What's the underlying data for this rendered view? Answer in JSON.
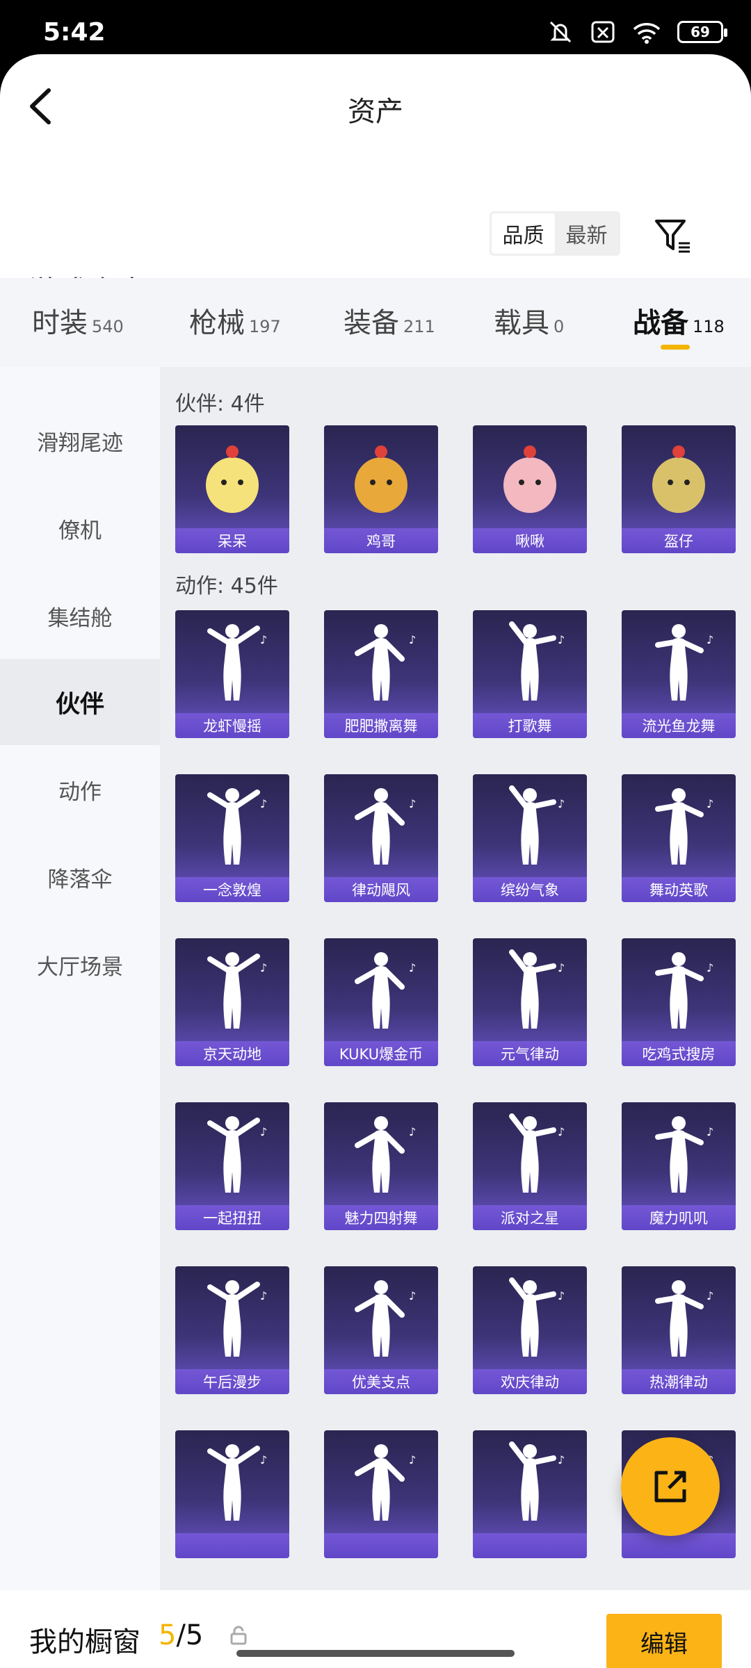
{
  "status_bar": {
    "time": "5:42",
    "battery": "69"
  },
  "nav": {
    "title": "资产"
  },
  "warehouse": {
    "title": "游戏仓库",
    "sort": [
      "品质",
      "最新"
    ]
  },
  "tabs": [
    {
      "name": "时装",
      "count": "540"
    },
    {
      "name": "枪械",
      "count": "197"
    },
    {
      "name": "装备",
      "count": "211"
    },
    {
      "name": "载具",
      "count": "0"
    },
    {
      "name": "战备",
      "count": "118"
    }
  ],
  "sidebar": [
    "滑翔尾迹",
    "僚机",
    "集结舱",
    "伙伴",
    "动作",
    "降落伞",
    "大厅场景"
  ],
  "groups": {
    "partners": {
      "label": "伙伴: 4件",
      "items": [
        "呆呆",
        "鸡哥",
        "啾啾",
        "盔仔"
      ]
    },
    "actions": {
      "label": "动作: 45件",
      "items": [
        "龙虾慢摇",
        "肥肥撒离舞",
        "打歌舞",
        "流光鱼龙舞",
        "一念敦煌",
        "律动飓风",
        "缤纷气象",
        "舞动英歌",
        "京天动地",
        "KUKU爆金币",
        "元气律动",
        "吃鸡式搜房",
        "一起扭扭",
        "魅力四射舞",
        "派对之星",
        "魔力叽叽",
        "午后漫步",
        "优美支点",
        "欢庆律动",
        "热潮律动",
        "",
        "",
        "",
        ""
      ]
    }
  },
  "bottom": {
    "showcase_label": "我的橱窗",
    "showcase_current": "5",
    "showcase_total": "/5",
    "edit": "编辑"
  },
  "colors": {
    "accent": "#fbb316",
    "card_top": "#2a2550",
    "card_bottom": "#6a55c8"
  }
}
